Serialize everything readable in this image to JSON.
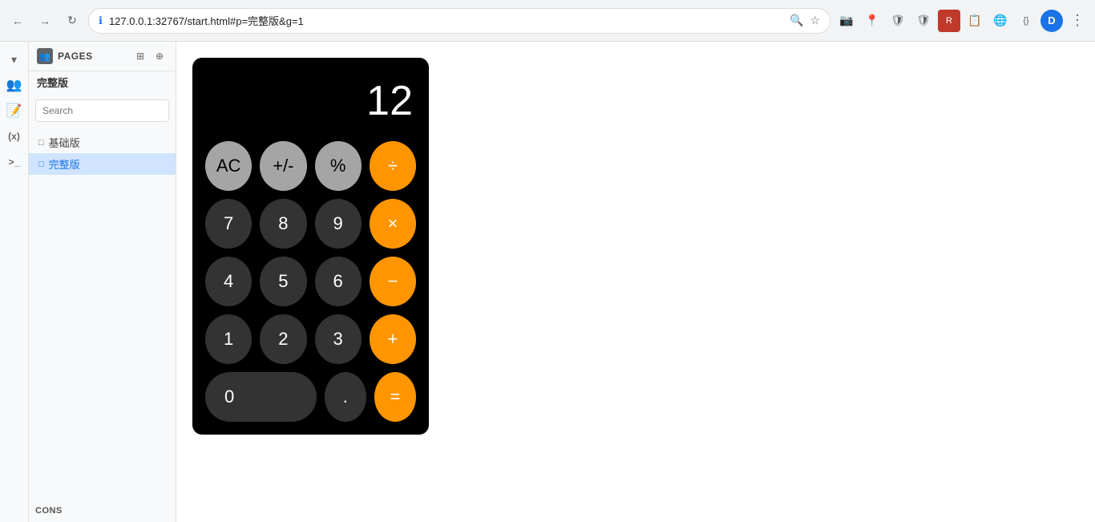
{
  "browser": {
    "url": "127.0.0.1:32767/start.html#p=完整版&g=1",
    "security_icon": "🔒",
    "back_label": "←",
    "forward_label": "→",
    "reload_label": "↻",
    "profile_initial": "D",
    "menu_label": "⋮",
    "star_icon": "☆",
    "search_icon": "🔍",
    "extension_icons": [
      "📷",
      "📍",
      "🛡",
      "🛡",
      "R",
      "📋",
      "🌐",
      "{}"
    ]
  },
  "sidebar": {
    "pages_label": "PAGES",
    "current_page": "完整版",
    "search_placeholder": "Search",
    "pages": [
      {
        "label": "基础版",
        "active": false
      },
      {
        "label": "完整版",
        "active": true
      }
    ],
    "sections": [
      {
        "label": "NOTES",
        "icon": "📝"
      },
      {
        "label": "(x)",
        "icon": "(x)"
      },
      {
        "label": "CONS",
        "icon": ">"
      }
    ],
    "header_actions": [
      "⊞",
      "⊕"
    ]
  },
  "calculator": {
    "display": "12",
    "buttons": {
      "row1": [
        "AC",
        "+/-",
        "%",
        "÷"
      ],
      "row2": [
        "7",
        "8",
        "9",
        "×"
      ],
      "row3": [
        "4",
        "5",
        "6",
        "−"
      ],
      "row4": [
        "1",
        "2",
        "3",
        "+"
      ],
      "row5_wide": "0",
      "row5_dot": ".",
      "row5_eq": "="
    }
  }
}
